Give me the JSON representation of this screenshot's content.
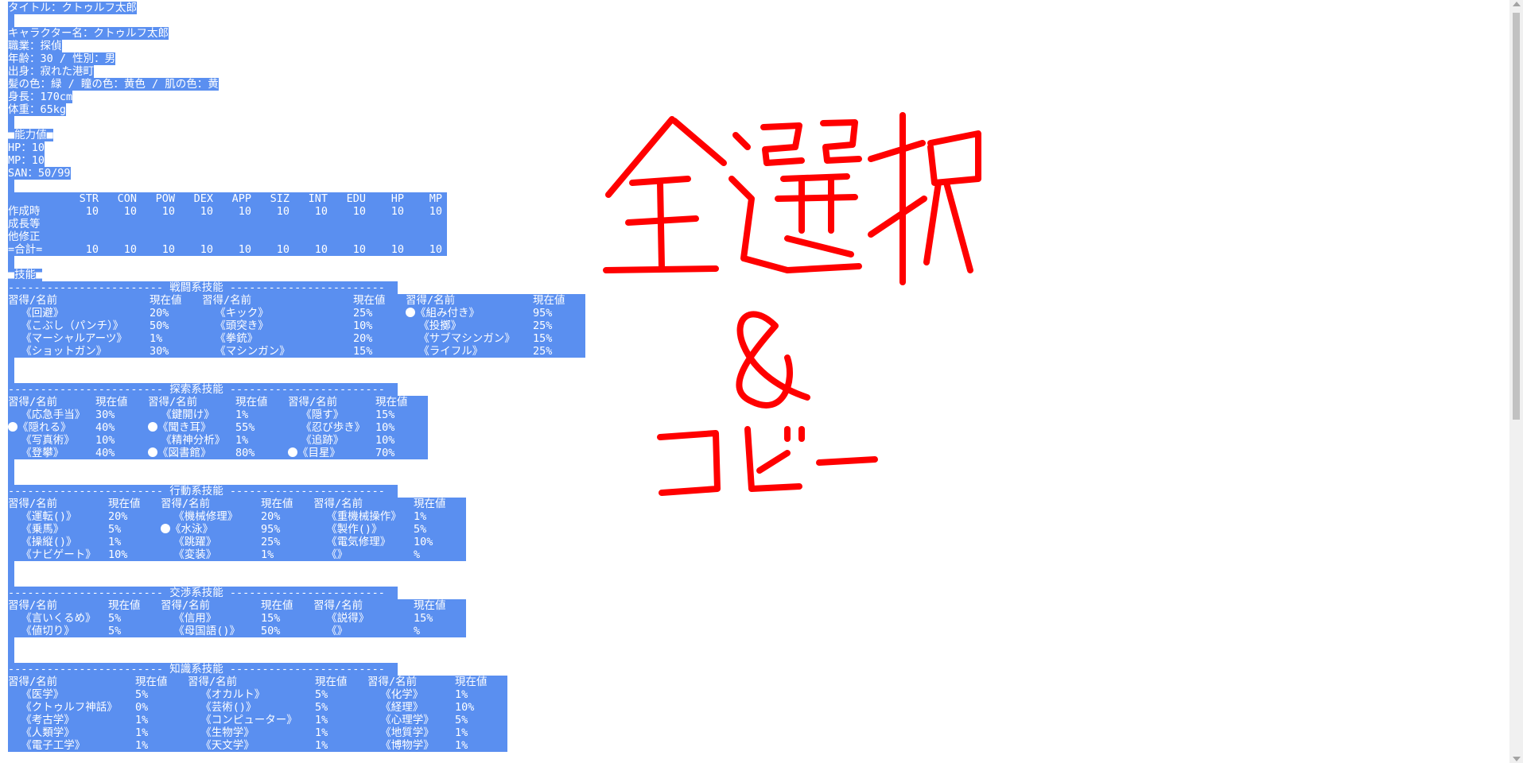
{
  "profile": {
    "title": "タイトル：クトゥルフ太郎",
    "name": "キャラクター名：クトゥルフ太郎",
    "job": "職業：探偵",
    "age_sex": "年齢：30 / 性別：男",
    "origin": "出身：寂れた港町",
    "colors": "髪の色：緑 / 瞳の色：黄色 / 肌の色：黄",
    "height": "身長：170cm",
    "weight": "体重：65kg"
  },
  "abilities": {
    "header": "■能力値■",
    "hp": "HP：10",
    "mp": "MP：10",
    "san": "SAN：50/99",
    "columns": [
      "STR",
      "CON",
      "POW",
      "DEX",
      "APP",
      "SIZ",
      "INT",
      "EDU",
      "HP",
      "MP"
    ],
    "rows": [
      {
        "label": "作成時",
        "values": [
          "10",
          "10",
          "10",
          "10",
          "10",
          "10",
          "10",
          "10",
          "10",
          "10"
        ]
      },
      {
        "label": "成長等",
        "values": []
      },
      {
        "label": "他修正",
        "values": []
      },
      {
        "label": "=合計=",
        "values": [
          "10",
          "10",
          "10",
          "10",
          "10",
          "10",
          "10",
          "10",
          "10",
          "10"
        ]
      }
    ]
  },
  "skills_header": "■技能■",
  "col_labels": {
    "name": "習得/名前",
    "value": "現在値"
  },
  "sections": [
    {
      "title": "------------------------ 戦闘系技能 ------------------------",
      "width": "wide",
      "rows": [
        [
          {
            "mark": false,
            "name": "《回避》",
            "value": "20%"
          },
          {
            "mark": false,
            "name": "《キック》",
            "value": "25%"
          },
          {
            "mark": true,
            "name": "《組み付き》",
            "value": "95%"
          }
        ],
        [
          {
            "mark": false,
            "name": "《こぶし（パンチ）》",
            "value": "50%"
          },
          {
            "mark": false,
            "name": "《頭突き》",
            "value": "10%"
          },
          {
            "mark": false,
            "name": "《投擲》",
            "value": "25%"
          }
        ],
        [
          {
            "mark": false,
            "name": "《マーシャルアーツ》",
            "value": "1%"
          },
          {
            "mark": false,
            "name": "《拳銃》",
            "value": "20%"
          },
          {
            "mark": false,
            "name": "《サブマシンガン》",
            "value": "15%"
          }
        ],
        [
          {
            "mark": false,
            "name": "《ショットガン》",
            "value": "30%"
          },
          {
            "mark": false,
            "name": "《マシンガン》",
            "value": "15%"
          },
          {
            "mark": false,
            "name": "《ライフル》",
            "value": "25%"
          }
        ]
      ]
    },
    {
      "title": "------------------------ 探索系技能 ------------------------",
      "width": "narrow",
      "rows": [
        [
          {
            "mark": false,
            "name": "《応急手当》",
            "value": "30%"
          },
          {
            "mark": false,
            "name": "《鍵開け》",
            "value": "1%"
          },
          {
            "mark": false,
            "name": "《隠す》",
            "value": "15%"
          }
        ],
        [
          {
            "mark": true,
            "name": "《隠れる》",
            "value": "40%"
          },
          {
            "mark": true,
            "name": "《聞き耳》",
            "value": "55%"
          },
          {
            "mark": false,
            "name": "《忍び歩き》",
            "value": "10%"
          }
        ],
        [
          {
            "mark": false,
            "name": "《写真術》",
            "value": "10%"
          },
          {
            "mark": false,
            "name": "《精神分析》",
            "value": "1%"
          },
          {
            "mark": false,
            "name": "《追跡》",
            "value": "10%"
          }
        ],
        [
          {
            "mark": false,
            "name": "《登攀》",
            "value": "40%"
          },
          {
            "mark": true,
            "name": "《図書館》",
            "value": "80%"
          },
          {
            "mark": true,
            "name": "《目星》",
            "value": "70%"
          }
        ]
      ]
    },
    {
      "title": "------------------------ 行動系技能 ------------------------",
      "width": "mid",
      "rows": [
        [
          {
            "mark": false,
            "name": "《運転()》",
            "value": "20%"
          },
          {
            "mark": false,
            "name": "《機械修理》",
            "value": "20%"
          },
          {
            "mark": false,
            "name": "《重機械操作》",
            "value": "1%"
          }
        ],
        [
          {
            "mark": false,
            "name": "《乗馬》",
            "value": "5%"
          },
          {
            "mark": true,
            "name": "《水泳》",
            "value": "95%"
          },
          {
            "mark": false,
            "name": "《製作()》",
            "value": "5%"
          }
        ],
        [
          {
            "mark": false,
            "name": "《操縦()》",
            "value": "1%"
          },
          {
            "mark": false,
            "name": "《跳躍》",
            "value": "25%"
          },
          {
            "mark": false,
            "name": "《電気修理》",
            "value": "10%"
          }
        ],
        [
          {
            "mark": false,
            "name": "《ナビゲート》",
            "value": "10%"
          },
          {
            "mark": false,
            "name": "《変装》",
            "value": "1%"
          },
          {
            "mark": false,
            "name": "《》",
            "value": "%"
          }
        ]
      ]
    },
    {
      "title": "------------------------ 交渉系技能 ------------------------",
      "width": "mid",
      "rows": [
        [
          {
            "mark": false,
            "name": "《言いくるめ》",
            "value": "5%"
          },
          {
            "mark": false,
            "name": "《信用》",
            "value": "15%"
          },
          {
            "mark": false,
            "name": "《説得》",
            "value": "15%"
          }
        ],
        [
          {
            "mark": false,
            "name": "《値切り》",
            "value": "5%"
          },
          {
            "mark": false,
            "name": "《母国語()》",
            "value": "50%"
          },
          {
            "mark": false,
            "name": "《》",
            "value": "%"
          }
        ]
      ]
    },
    {
      "title": "------------------------ 知識系技能 ------------------------",
      "width": "wide2",
      "rows": [
        [
          {
            "mark": false,
            "name": "《医学》",
            "value": "5%"
          },
          {
            "mark": false,
            "name": "《オカルト》",
            "value": "5%"
          },
          {
            "mark": false,
            "name": "《化学》",
            "value": "1%"
          }
        ],
        [
          {
            "mark": false,
            "name": "《クトゥルフ神話》",
            "value": "0%"
          },
          {
            "mark": false,
            "name": "《芸術()》",
            "value": "5%"
          },
          {
            "mark": false,
            "name": "《経理》",
            "value": "10%"
          }
        ],
        [
          {
            "mark": false,
            "name": "《考古学》",
            "value": "1%"
          },
          {
            "mark": false,
            "name": "《コンピューター》",
            "value": "1%"
          },
          {
            "mark": false,
            "name": "《心理学》",
            "value": "5%"
          }
        ],
        [
          {
            "mark": false,
            "name": "《人類学》",
            "value": "1%"
          },
          {
            "mark": false,
            "name": "《生物学》",
            "value": "1%"
          },
          {
            "mark": false,
            "name": "《地質学》",
            "value": "1%"
          }
        ],
        [
          {
            "mark": false,
            "name": "《電子工学》",
            "value": "1%"
          },
          {
            "mark": false,
            "name": "《天文学》",
            "value": "1%"
          },
          {
            "mark": false,
            "name": "《博物学》",
            "value": "1%"
          }
        ]
      ]
    }
  ],
  "annotation": {
    "line1": "全選択",
    "line2": "&",
    "line3": "コピー",
    "color": "#ff0000"
  },
  "selection_color": "#5a8ff0"
}
